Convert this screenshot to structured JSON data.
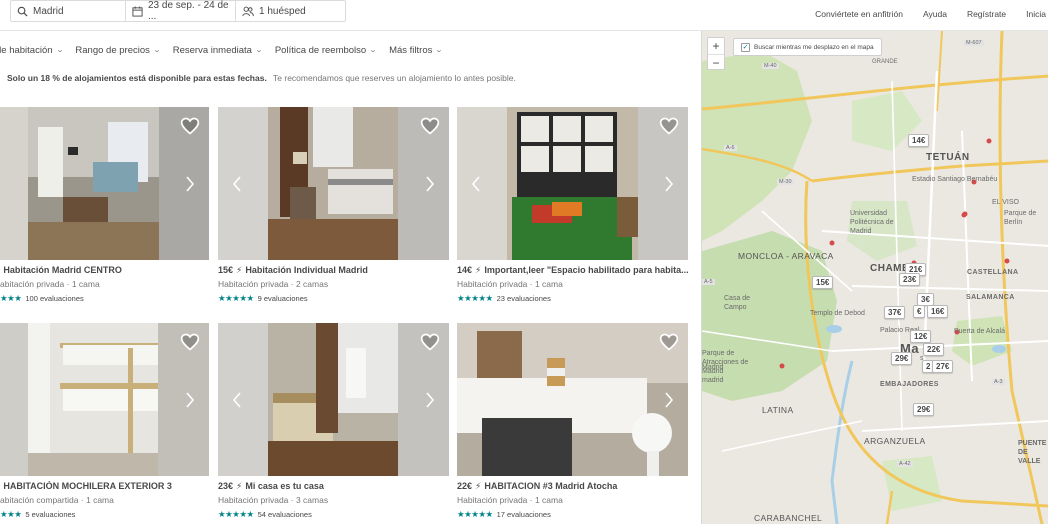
{
  "search": {
    "location": "Madrid",
    "dates": "23 de sep. - 24 de ...",
    "guests": "1 huésped"
  },
  "topnav": {
    "host": "Conviértete en anfitrión",
    "help": "Ayuda",
    "signup": "Regístrate",
    "login": "Inicia"
  },
  "filters": [
    "de habitación",
    "Rango de precios",
    "Reserva inmediata",
    "Política de reembolso",
    "Más filtros"
  ],
  "notice": {
    "bold": "Solo un 18 % de alojamientos está disponible para estas fechas.",
    "sub": "Te recomendamos que reserves un alojamiento lo antes posible."
  },
  "listings": [
    {
      "price": "",
      "title": "Habitación Madrid CENTRO",
      "type": "abitación privada · 1 cama",
      "stars": "★★★",
      "reviews": "100 evaluaciones"
    },
    {
      "price": "15€",
      "title": "Habitación Individual Madrid",
      "type": "Habitación privada · 2 camas",
      "stars": "★★★★★",
      "reviews": "9 evaluaciones"
    },
    {
      "price": "14€",
      "title": "Important,leer \"Espacio habilitado para habita...",
      "type": "Habitación privada · 1 cama",
      "stars": "★★★★★",
      "reviews": "23 evaluaciones"
    },
    {
      "price": "",
      "title": "HABITACIÓN MOCHILERA EXTERIOR 3",
      "type": "abitación compartida · 1 cama",
      "stars": "★★★",
      "reviews": "5 evaluaciones"
    },
    {
      "price": "23€",
      "title": "Mi casa es tu casa",
      "type": "Habitación privada · 3 camas",
      "stars": "★★★★★",
      "reviews": "54 evaluaciones"
    },
    {
      "price": "22€",
      "title": "HABITACION #3 Madrid Atocha",
      "type": "Habitación privada · 1 cama",
      "stars": "★★★★★",
      "reviews": "17 evaluaciones"
    }
  ],
  "map": {
    "zoom_in": "+",
    "zoom_out": "−",
    "search_checkbox": "Buscar mientras me desplazo en el mapa",
    "pins": [
      "14€",
      "21€",
      "23€",
      "15€",
      "3€",
      "37€",
      "€",
      "16€",
      "12€",
      "22€",
      "29€",
      "2",
      "27€",
      "29€"
    ],
    "labels": [
      "TETUÁN",
      "Estadio Santiago Bernabéu",
      "MONCLOA - ARAVACA",
      "CHAMB",
      "Universidad Politécnica de Madrid",
      "Casa de Campo",
      "Templo de Debod",
      "Palacio Real",
      "Ma",
      "CASTELLANA",
      "SALAMANCA",
      "Puerta de Alcalá",
      "Parque de Atracciones de Madrid",
      "EMBAJADORES",
      "LATINA",
      "ARGANZUELA",
      "CARABANCHEL",
      "PUENTE DE VALLE",
      "EL VISO",
      "Parque de Berlín",
      "M-30",
      "A-6",
      "M-40",
      "A-42",
      "A-5",
      "M-607",
      "madrid",
      "GRANDE",
      "Madrid",
      "s",
      "A-3"
    ]
  },
  "colors": {
    "teal": "#008489",
    "text": "#484848",
    "muted": "#767676"
  }
}
